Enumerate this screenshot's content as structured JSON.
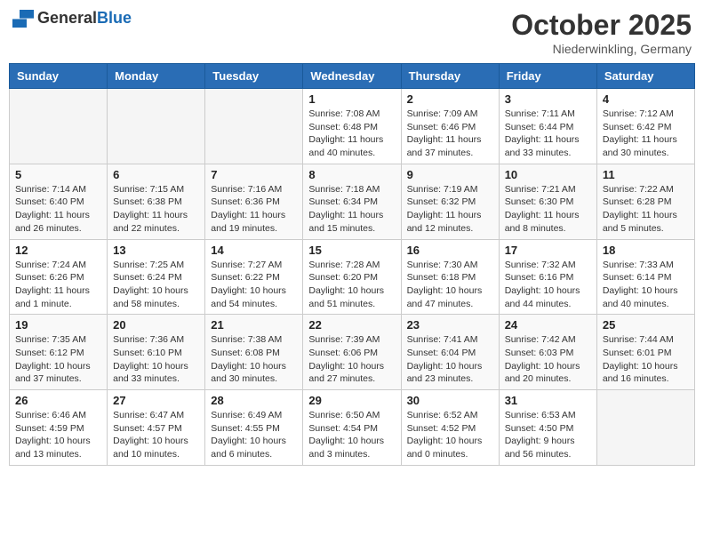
{
  "header": {
    "logo_general": "General",
    "logo_blue": "Blue",
    "month_title": "October 2025",
    "location": "Niederwinkling, Germany"
  },
  "days_of_week": [
    "Sunday",
    "Monday",
    "Tuesday",
    "Wednesday",
    "Thursday",
    "Friday",
    "Saturday"
  ],
  "weeks": [
    [
      {
        "day": "",
        "info": ""
      },
      {
        "day": "",
        "info": ""
      },
      {
        "day": "",
        "info": ""
      },
      {
        "day": "1",
        "info": "Sunrise: 7:08 AM\nSunset: 6:48 PM\nDaylight: 11 hours\nand 40 minutes."
      },
      {
        "day": "2",
        "info": "Sunrise: 7:09 AM\nSunset: 6:46 PM\nDaylight: 11 hours\nand 37 minutes."
      },
      {
        "day": "3",
        "info": "Sunrise: 7:11 AM\nSunset: 6:44 PM\nDaylight: 11 hours\nand 33 minutes."
      },
      {
        "day": "4",
        "info": "Sunrise: 7:12 AM\nSunset: 6:42 PM\nDaylight: 11 hours\nand 30 minutes."
      }
    ],
    [
      {
        "day": "5",
        "info": "Sunrise: 7:14 AM\nSunset: 6:40 PM\nDaylight: 11 hours\nand 26 minutes."
      },
      {
        "day": "6",
        "info": "Sunrise: 7:15 AM\nSunset: 6:38 PM\nDaylight: 11 hours\nand 22 minutes."
      },
      {
        "day": "7",
        "info": "Sunrise: 7:16 AM\nSunset: 6:36 PM\nDaylight: 11 hours\nand 19 minutes."
      },
      {
        "day": "8",
        "info": "Sunrise: 7:18 AM\nSunset: 6:34 PM\nDaylight: 11 hours\nand 15 minutes."
      },
      {
        "day": "9",
        "info": "Sunrise: 7:19 AM\nSunset: 6:32 PM\nDaylight: 11 hours\nand 12 minutes."
      },
      {
        "day": "10",
        "info": "Sunrise: 7:21 AM\nSunset: 6:30 PM\nDaylight: 11 hours\nand 8 minutes."
      },
      {
        "day": "11",
        "info": "Sunrise: 7:22 AM\nSunset: 6:28 PM\nDaylight: 11 hours\nand 5 minutes."
      }
    ],
    [
      {
        "day": "12",
        "info": "Sunrise: 7:24 AM\nSunset: 6:26 PM\nDaylight: 11 hours\nand 1 minute."
      },
      {
        "day": "13",
        "info": "Sunrise: 7:25 AM\nSunset: 6:24 PM\nDaylight: 10 hours\nand 58 minutes."
      },
      {
        "day": "14",
        "info": "Sunrise: 7:27 AM\nSunset: 6:22 PM\nDaylight: 10 hours\nand 54 minutes."
      },
      {
        "day": "15",
        "info": "Sunrise: 7:28 AM\nSunset: 6:20 PM\nDaylight: 10 hours\nand 51 minutes."
      },
      {
        "day": "16",
        "info": "Sunrise: 7:30 AM\nSunset: 6:18 PM\nDaylight: 10 hours\nand 47 minutes."
      },
      {
        "day": "17",
        "info": "Sunrise: 7:32 AM\nSunset: 6:16 PM\nDaylight: 10 hours\nand 44 minutes."
      },
      {
        "day": "18",
        "info": "Sunrise: 7:33 AM\nSunset: 6:14 PM\nDaylight: 10 hours\nand 40 minutes."
      }
    ],
    [
      {
        "day": "19",
        "info": "Sunrise: 7:35 AM\nSunset: 6:12 PM\nDaylight: 10 hours\nand 37 minutes."
      },
      {
        "day": "20",
        "info": "Sunrise: 7:36 AM\nSunset: 6:10 PM\nDaylight: 10 hours\nand 33 minutes."
      },
      {
        "day": "21",
        "info": "Sunrise: 7:38 AM\nSunset: 6:08 PM\nDaylight: 10 hours\nand 30 minutes."
      },
      {
        "day": "22",
        "info": "Sunrise: 7:39 AM\nSunset: 6:06 PM\nDaylight: 10 hours\nand 27 minutes."
      },
      {
        "day": "23",
        "info": "Sunrise: 7:41 AM\nSunset: 6:04 PM\nDaylight: 10 hours\nand 23 minutes."
      },
      {
        "day": "24",
        "info": "Sunrise: 7:42 AM\nSunset: 6:03 PM\nDaylight: 10 hours\nand 20 minutes."
      },
      {
        "day": "25",
        "info": "Sunrise: 7:44 AM\nSunset: 6:01 PM\nDaylight: 10 hours\nand 16 minutes."
      }
    ],
    [
      {
        "day": "26",
        "info": "Sunrise: 6:46 AM\nSunset: 4:59 PM\nDaylight: 10 hours\nand 13 minutes."
      },
      {
        "day": "27",
        "info": "Sunrise: 6:47 AM\nSunset: 4:57 PM\nDaylight: 10 hours\nand 10 minutes."
      },
      {
        "day": "28",
        "info": "Sunrise: 6:49 AM\nSunset: 4:55 PM\nDaylight: 10 hours\nand 6 minutes."
      },
      {
        "day": "29",
        "info": "Sunrise: 6:50 AM\nSunset: 4:54 PM\nDaylight: 10 hours\nand 3 minutes."
      },
      {
        "day": "30",
        "info": "Sunrise: 6:52 AM\nSunset: 4:52 PM\nDaylight: 10 hours\nand 0 minutes."
      },
      {
        "day": "31",
        "info": "Sunrise: 6:53 AM\nSunset: 4:50 PM\nDaylight: 9 hours\nand 56 minutes."
      },
      {
        "day": "",
        "info": ""
      }
    ]
  ]
}
